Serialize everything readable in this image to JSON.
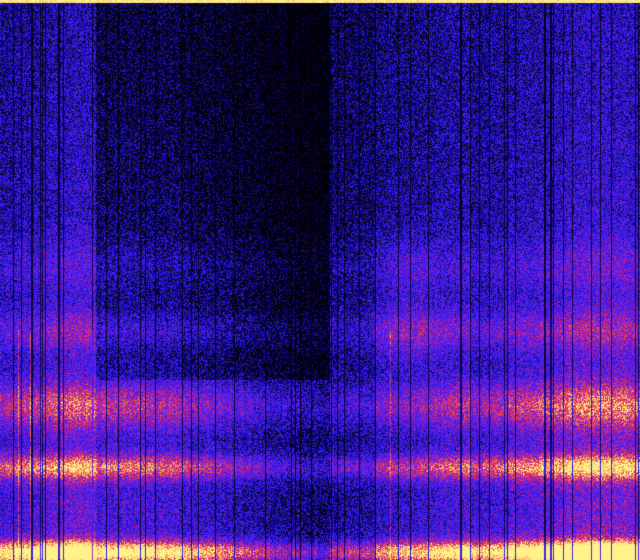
{
  "image": {
    "kind": "spectrogram",
    "colormap": "black-blue-magenta-orange-yellow",
    "palette": {
      "black": "#000000",
      "blue": "#2a1cff",
      "violet": "#6a1fd8",
      "magenta": "#d1208e",
      "orange": "#f25a3a",
      "yellow": "#fff28a",
      "pale_yellow": "#fff7a6"
    },
    "has_text": false
  }
}
